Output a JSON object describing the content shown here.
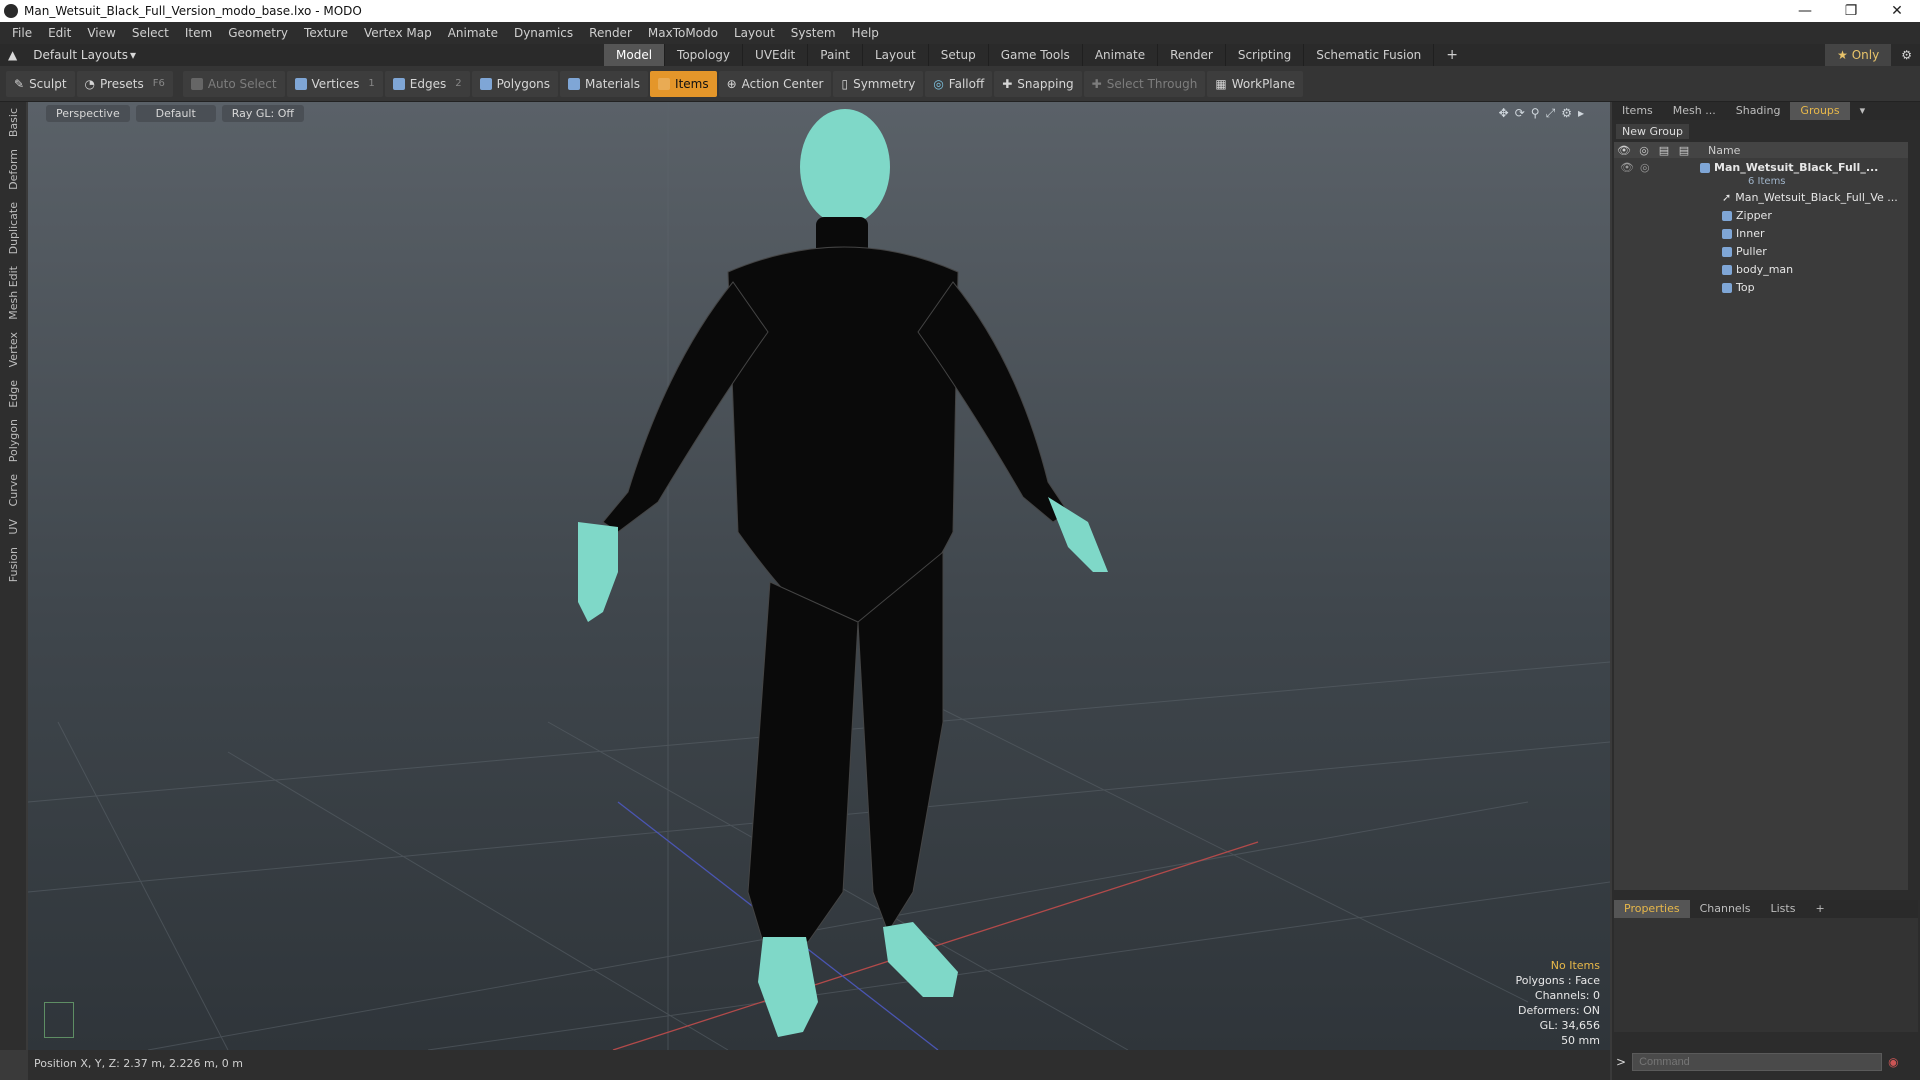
{
  "window": {
    "title": "Man_Wetsuit_Black_Full_Version_modo_base.lxo - MODO"
  },
  "menu": [
    "File",
    "Edit",
    "View",
    "Select",
    "Item",
    "Geometry",
    "Texture",
    "Vertex Map",
    "Animate",
    "Dynamics",
    "Render",
    "MaxToModo",
    "Layout",
    "System",
    "Help"
  ],
  "layout": {
    "selector": "Default Layouts",
    "tabs": [
      "Model",
      "Topology",
      "UVEdit",
      "Paint",
      "Layout",
      "Setup",
      "Game Tools",
      "Animate",
      "Render",
      "Scripting",
      "Schematic Fusion"
    ],
    "active_tab": "Model",
    "only_label": "Only"
  },
  "toolbar": {
    "sculpt": "Sculpt",
    "presets": "Presets",
    "presets_key": "F6",
    "auto_select": "Auto Select",
    "vertices": "Vertices",
    "vertices_key": "1",
    "edges": "Edges",
    "edges_key": "2",
    "polygons": "Polygons",
    "materials": "Materials",
    "items": "Items",
    "action_center": "Action Center",
    "symmetry": "Symmetry",
    "falloff": "Falloff",
    "snapping": "Snapping",
    "select_through": "Select Through",
    "workplane": "WorkPlane"
  },
  "left_tabs": [
    "Basic",
    "Deform",
    "Duplicate",
    "Mesh Edit",
    "Vertex",
    "Edge",
    "Polygon",
    "Curve",
    "UV",
    "Fusion"
  ],
  "viewport": {
    "view": "Perspective",
    "shading": "Default",
    "raygl": "Ray GL: Off",
    "info": {
      "selection": "No Items",
      "polygons": "Polygons : Face",
      "channels": "Channels: 0",
      "deformers": "Deformers: ON",
      "gl": "GL: 34,656",
      "scale": "50 mm"
    }
  },
  "status": {
    "position": "Position X, Y, Z:  2.37 m, 2.226 m, 0 m"
  },
  "right_panel": {
    "tabs": [
      "Items",
      "Mesh ...",
      "Shading",
      "Groups"
    ],
    "active_tab": "Groups",
    "new_group": "New Group",
    "name_col": "Name",
    "root": {
      "label": "Man_Wetsuit_Black_Full_...",
      "count": "6 Items"
    },
    "children": [
      "Man_Wetsuit_Black_Full_Ve ...",
      "Zipper",
      "Inner",
      "Puller",
      "body_man",
      "Top"
    ]
  },
  "bottom_panel": {
    "tabs": [
      "Properties",
      "Channels",
      "Lists"
    ],
    "active_tab": "Properties",
    "command_placeholder": "Command"
  },
  "colors": {
    "accent": "#e4962a",
    "mesh_skin": "#7fd8c8",
    "suit": "#0a0a0a"
  }
}
